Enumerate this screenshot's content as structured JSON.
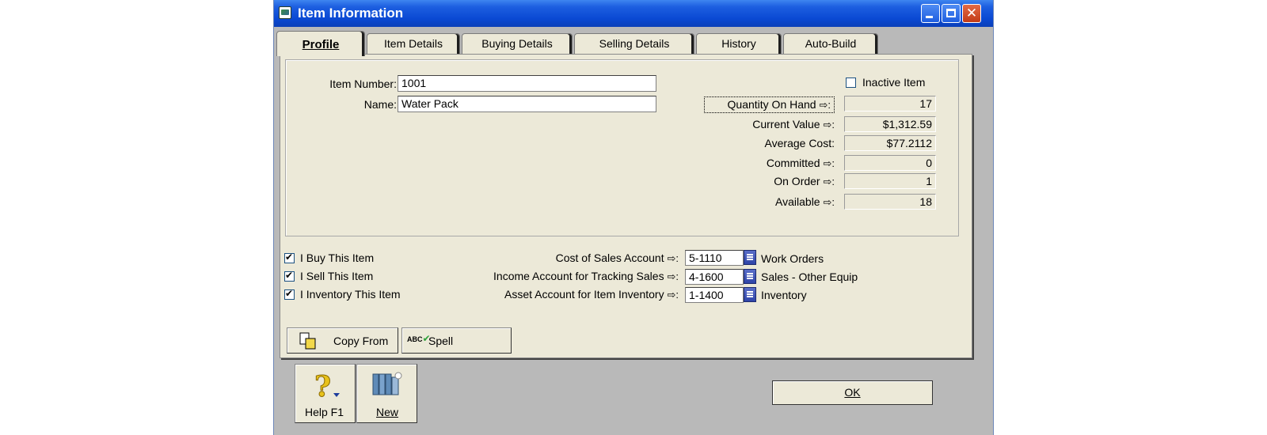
{
  "window": {
    "title": "Item Information"
  },
  "tabs": [
    {
      "label": "Profile"
    },
    {
      "label": "Item Details"
    },
    {
      "label": "Buying Details"
    },
    {
      "label": "Selling Details"
    },
    {
      "label": "History"
    },
    {
      "label": "Auto-Build"
    }
  ],
  "profile": {
    "item_number_label": "Item Number:",
    "item_number": "1001",
    "name_label": "Name:",
    "name": "Water Pack",
    "inactive_label": "Inactive Item",
    "inactive_checked": false,
    "stats": [
      {
        "label": "Quantity On Hand",
        "arrow": "⇨:",
        "value": "17"
      },
      {
        "label": "Current Value",
        "arrow": "⇨:",
        "value": "$1,312.59"
      },
      {
        "label": "Average Cost:",
        "arrow": "",
        "value": "$77.2112"
      },
      {
        "label": "Committed",
        "arrow": "⇨:",
        "value": "0"
      },
      {
        "label": "On Order",
        "arrow": "⇨:",
        "value": "1"
      },
      {
        "label": "Available",
        "arrow": "⇨:",
        "value": "18"
      }
    ]
  },
  "flags": [
    {
      "label": "I Buy This Item",
      "checked": true
    },
    {
      "label": "I Sell This Item",
      "checked": true
    },
    {
      "label": "I Inventory This Item",
      "checked": true
    }
  ],
  "accounts": [
    {
      "label": "Cost of Sales Account",
      "arrow": "⇨:",
      "code": "5-1110",
      "name": "Work Orders"
    },
    {
      "label": "Income Account for Tracking Sales",
      "arrow": "⇨:",
      "code": "4-1600",
      "name": "Sales - Other Equip"
    },
    {
      "label": "Asset Account for Item Inventory",
      "arrow": "⇨:",
      "code": "1-1400",
      "name": "Inventory"
    }
  ],
  "buttons": {
    "copy_from": "Copy From",
    "spell": "Spell",
    "spell_icon_text": "ABC",
    "help": "Help F1",
    "new": "New",
    "ok": "OK"
  }
}
